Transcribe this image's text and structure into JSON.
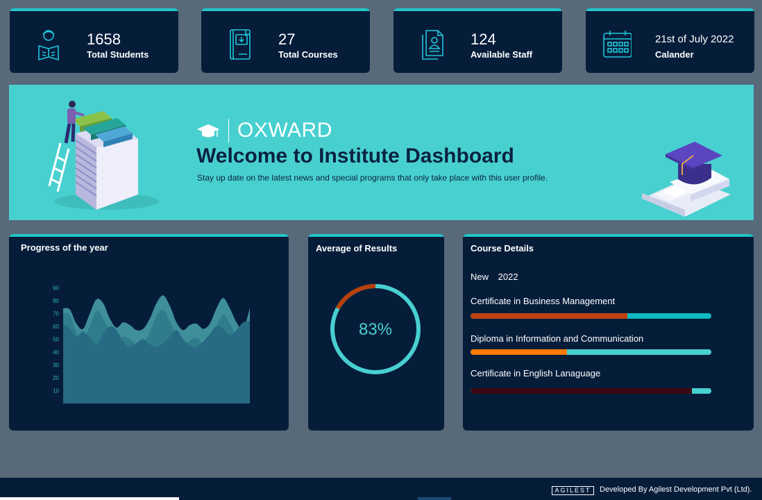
{
  "stats": [
    {
      "value": "1658",
      "label": "Total Students",
      "icon": "student-reading-icon"
    },
    {
      "value": "27",
      "label": "Total Courses",
      "icon": "book-download-icon"
    },
    {
      "value": "124",
      "label": "Available Staff",
      "icon": "staff-id-icon"
    },
    {
      "value": "21st of July 2022",
      "label": "Calander",
      "icon": "calendar-icon"
    }
  ],
  "banner": {
    "brand": "OXWARD",
    "title": "Welcome to Institute Dashboard",
    "subtitle": "Stay up date on the latest news and special programs that only take place with this user profile."
  },
  "progress": {
    "title": "Progress of the year",
    "chart_data": {
      "type": "area",
      "title": "",
      "xlabel": "",
      "ylabel": "",
      "ylim": [
        0,
        95
      ],
      "yticks": [
        10,
        20,
        30,
        40,
        50,
        60,
        70,
        80,
        90
      ],
      "x": [
        0,
        1,
        2,
        3,
        4,
        5,
        6,
        7,
        8,
        9,
        10,
        11,
        12,
        13,
        14,
        15,
        16,
        17,
        18,
        19,
        20,
        21,
        22,
        23,
        24,
        25,
        26,
        27,
        28
      ],
      "series": [
        {
          "values": [
            74,
            73,
            62,
            58,
            70,
            81,
            78,
            66,
            59,
            63,
            61,
            57,
            58,
            66,
            78,
            84,
            76,
            63,
            57,
            61,
            62,
            58,
            62,
            74,
            82,
            74,
            63,
            58,
            74
          ],
          "color": "#3e8f99"
        },
        {
          "values": [
            70,
            69,
            55,
            50,
            60,
            72,
            66,
            56,
            48,
            52,
            50,
            46,
            47,
            55,
            68,
            73,
            64,
            52,
            46,
            49,
            51,
            47,
            50,
            60,
            69,
            62,
            52,
            47,
            62
          ],
          "color": "#2f7c8c"
        },
        {
          "values": [
            62,
            58,
            52,
            56,
            51,
            46,
            54,
            60,
            57,
            48,
            44,
            47,
            50,
            46,
            44,
            47,
            52,
            57,
            50,
            45,
            44,
            48,
            54,
            60,
            58,
            53,
            57,
            63,
            64
          ],
          "color": "#276a83"
        }
      ]
    }
  },
  "results": {
    "title": "Average of Results",
    "value_text": "83%",
    "value": 83,
    "ring_color": "#48d0d0",
    "accent_color": "#b8400a"
  },
  "courses": {
    "title": "Course Details",
    "filter_label": "New",
    "filter_year": "2022",
    "items": [
      {
        "name": "Certificate in Business Management",
        "progress": 0.65,
        "fill": "#bf4210",
        "track": "#0fbac0"
      },
      {
        "name": "Diploma in Information and Communication",
        "progress": 0.4,
        "fill": "#ff7a0a",
        "track": "#48d0d0"
      },
      {
        "name": "Certificate in English Lanaguage",
        "progress": 0.92,
        "fill": "#3a0810",
        "track": "#48d0d0"
      }
    ]
  },
  "footer": {
    "logo": "AGILEST",
    "credit": "Developed By Agilest Development Pvt (Ltd)."
  }
}
